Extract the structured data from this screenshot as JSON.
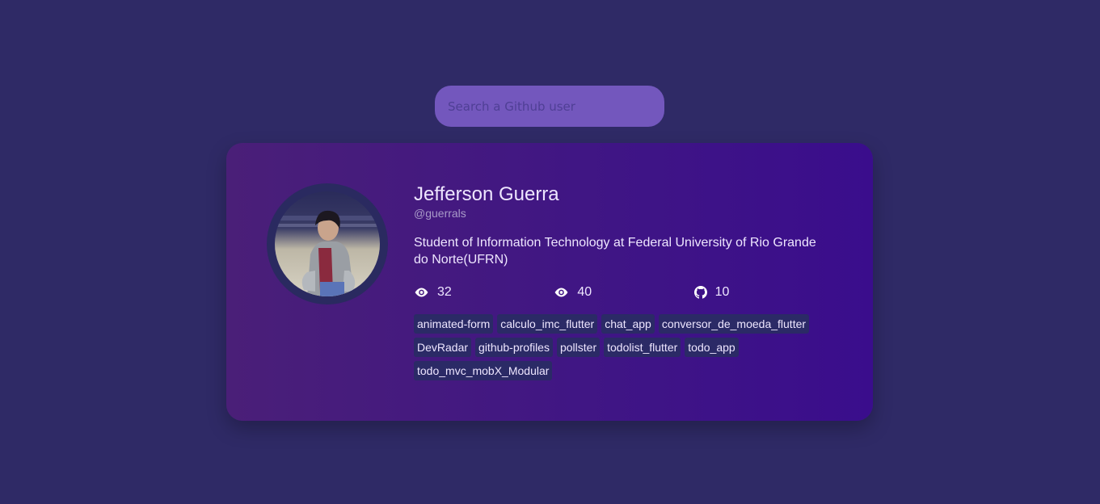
{
  "search": {
    "placeholder": "Search a Github user",
    "value": ""
  },
  "profile": {
    "name": "Jefferson Guerra",
    "handle": "@guerrals",
    "bio": "Student of Information Technology at Federal University of Rio Grande do Norte(UFRN)",
    "avatar_icon": "user-photo",
    "stats": [
      {
        "icon": "eye-icon",
        "value": "32"
      },
      {
        "icon": "eye-icon",
        "value": "40"
      },
      {
        "icon": "github-icon",
        "value": "10"
      }
    ],
    "repos": [
      "animated-form",
      "calculo_imc_flutter",
      "chat_app",
      "conversor_de_moeda_flutter",
      "DevRadar",
      "github-profiles",
      "pollster",
      "todolist_flutter",
      "todo_app",
      "todo_mvc_mobX_Modular"
    ]
  },
  "colors": {
    "background": "#2f2a66",
    "search_bg": "#7357bd",
    "card_gradient_start": "#4a1f78",
    "card_gradient_end": "#3a0d8c",
    "repo_tag_bg": "#2b2a66"
  }
}
